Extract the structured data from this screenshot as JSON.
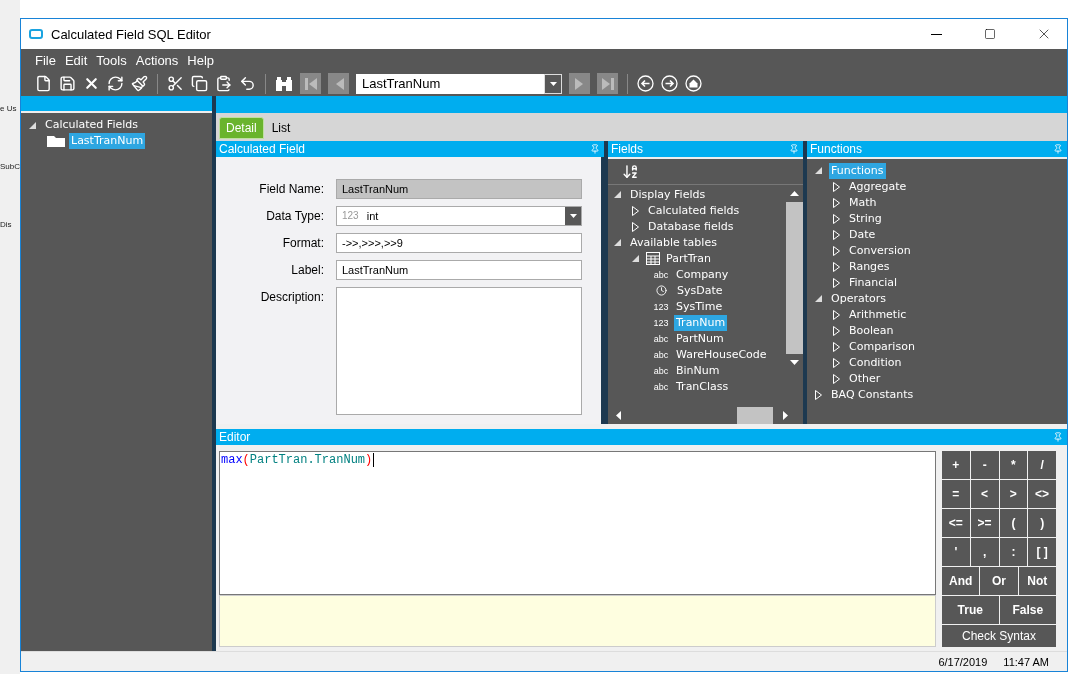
{
  "background_window": {
    "fragments": [
      "e Us",
      "SubC",
      "Dis"
    ]
  },
  "window": {
    "title": "Calculated Field SQL Editor"
  },
  "menu": [
    "File",
    "Edit",
    "Tools",
    "Actions",
    "Help"
  ],
  "toolbar": {
    "record_value": "LastTranNum"
  },
  "left_tree": [
    {
      "label": "Calculated Fields",
      "expanded": true,
      "selected": false,
      "children": [
        {
          "label": "LastTranNum",
          "kind": "folder",
          "selected": true
        }
      ]
    }
  ],
  "tabs": [
    {
      "label": "Detail",
      "selected": true
    },
    {
      "label": "List",
      "selected": false
    }
  ],
  "calculated_field": {
    "title": "Calculated Field",
    "rows": [
      {
        "label": "Field Name:",
        "kind": "readonly",
        "value": "LastTranNum"
      },
      {
        "label": "Data Type:",
        "kind": "dropdown",
        "icon_text": "123",
        "value": "int"
      },
      {
        "label": "Format:",
        "kind": "text",
        "value": "->>,>>>,>>9"
      },
      {
        "label": "Label:",
        "kind": "text",
        "value": "LastTranNum"
      },
      {
        "label": "Description:",
        "kind": "textarea",
        "value": ""
      }
    ]
  },
  "fields": {
    "title": "Fields",
    "tree": [
      {
        "label": "Display Fields",
        "expanded": true,
        "selected": false,
        "children": [
          {
            "label": "Calculated fields",
            "expanded": false,
            "selected": false
          },
          {
            "label": "Database fields",
            "expanded": false,
            "selected": false
          }
        ]
      },
      {
        "label": "Available tables",
        "expanded": true,
        "selected": false,
        "children": [
          {
            "label": "PartTran",
            "kind": "table",
            "expanded": true,
            "selected": false,
            "children": [
              {
                "label": "Company",
                "kind": "field",
                "badge": "abc",
                "selected": false
              },
              {
                "label": "SysDate",
                "kind": "date",
                "selected": false
              },
              {
                "label": "SysTime",
                "kind": "field",
                "badge": "123",
                "selected": false
              },
              {
                "label": "TranNum",
                "kind": "field",
                "badge": "123",
                "selected": true
              },
              {
                "label": "PartNum",
                "kind": "field",
                "badge": "abc",
                "selected": false
              },
              {
                "label": "WareHouseCode",
                "kind": "field",
                "badge": "abc",
                "selected": false
              },
              {
                "label": "BinNum",
                "kind": "field",
                "badge": "abc",
                "selected": false
              },
              {
                "label": "TranClass",
                "kind": "field",
                "badge": "abc",
                "selected": false
              }
            ]
          }
        ]
      }
    ]
  },
  "functions": {
    "title": "Functions",
    "tree": [
      {
        "label": "Functions",
        "expanded": true,
        "selected": true,
        "children": [
          {
            "label": "Aggregate",
            "expanded": false,
            "selected": false
          },
          {
            "label": "Math",
            "expanded": false,
            "selected": false
          },
          {
            "label": "String",
            "expanded": false,
            "selected": false
          },
          {
            "label": "Date",
            "expanded": false,
            "selected": false
          },
          {
            "label": "Conversion",
            "expanded": false,
            "selected": false
          },
          {
            "label": "Ranges",
            "expanded": false,
            "selected": false
          },
          {
            "label": "Financial",
            "expanded": false,
            "selected": false
          }
        ]
      },
      {
        "label": "Operators",
        "expanded": true,
        "selected": false,
        "children": [
          {
            "label": "Arithmetic",
            "expanded": false,
            "selected": false
          },
          {
            "label": "Boolean",
            "expanded": false,
            "selected": false
          },
          {
            "label": "Comparison",
            "expanded": false,
            "selected": false
          },
          {
            "label": "Condition",
            "expanded": false,
            "selected": false
          },
          {
            "label": "Other",
            "expanded": false,
            "selected": false
          }
        ]
      },
      {
        "label": "BAQ Constants",
        "expanded": false,
        "selected": false
      }
    ]
  },
  "editor": {
    "title": "Editor",
    "code": [
      {
        "kind": "function",
        "text": "max"
      },
      {
        "kind": "paren",
        "text": "("
      },
      {
        "kind": "identifier",
        "text": "PartTran.TranNum"
      },
      {
        "kind": "paren",
        "text": ")"
      }
    ],
    "keypad": [
      [
        "+",
        "-",
        "*",
        "/"
      ],
      [
        "=",
        "<",
        ">",
        "<>"
      ],
      [
        "<=",
        ">=",
        "(",
        ")"
      ],
      [
        "'",
        ",",
        ":",
        "[ ]"
      ],
      [
        "And",
        "Or",
        "Not"
      ],
      [
        "True",
        "False"
      ],
      [
        "Check Syntax"
      ]
    ]
  },
  "status_bar": {
    "date": "6/17/2019",
    "time": "11:47 AM"
  }
}
